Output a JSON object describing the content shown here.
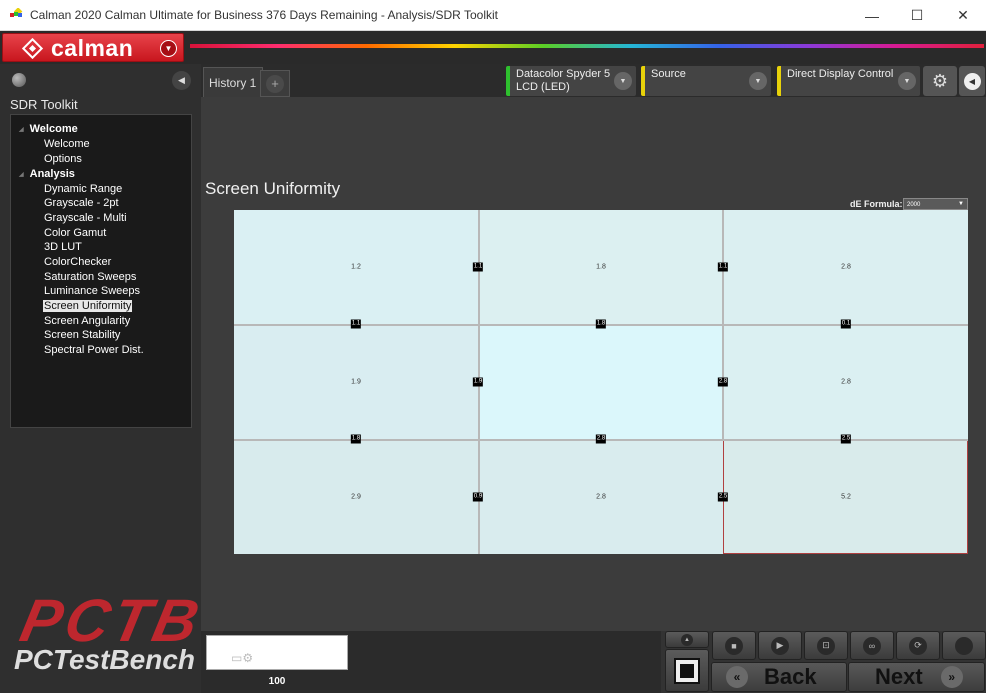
{
  "window": {
    "title": "Calman 2020 Calman Ultimate for Business 376 Days Remaining - Analysis/SDR Toolkit",
    "minimize": "—",
    "maximize": "☐",
    "close": "✕"
  },
  "brand": {
    "name": "calman",
    "accent": "#d8202a"
  },
  "sidebar": {
    "title": "SDR Toolkit",
    "groups": [
      {
        "label": "Welcome",
        "items": [
          "Welcome",
          "Options"
        ]
      },
      {
        "label": "Analysis",
        "items": [
          "Dynamic Range",
          "Grayscale - 2pt",
          "Grayscale - Multi",
          "Color Gamut",
          "3D LUT",
          "ColorChecker",
          "Saturation Sweeps",
          "Luminance Sweeps",
          "Screen Uniformity",
          "Screen Angularity",
          "Screen Stability",
          "Spectral Power Dist."
        ]
      }
    ],
    "selected": "Screen Uniformity"
  },
  "tabs": {
    "history": "History 1",
    "add": "+"
  },
  "devices": {
    "meter_line1": "Datacolor Spyder 5",
    "meter_line2": "LCD (LED)",
    "source": "Source",
    "display": "Direct Display Control"
  },
  "page": {
    "title": "Screen Uniformity",
    "de_formula_label": "dE Formula:",
    "de_formula_value": "2000"
  },
  "uniformity": {
    "rows": 3,
    "cols": 3,
    "center_values": [
      [
        "1.2",
        "1.8",
        "2.8"
      ],
      [
        "1.9",
        "",
        "2.8"
      ],
      [
        "2.9",
        "2.8",
        "5.2"
      ]
    ],
    "edge_tags": {
      "row0_v": [
        "1.1",
        "1.1"
      ],
      "row1_v": [
        "1.9",
        "2.8"
      ],
      "row2_v": [
        "0.9",
        "2.5"
      ],
      "hline1": [
        "1.1",
        "1.8",
        "0.1"
      ],
      "hline2": [
        "1.8",
        "2.8",
        "2.5"
      ]
    },
    "highlight_cell": "r2c2"
  },
  "bottom": {
    "swatch_value": "100",
    "back_label": "Back",
    "next_label": "Next"
  },
  "watermark": {
    "big": "PCTB",
    "small": "PCTestBench"
  }
}
